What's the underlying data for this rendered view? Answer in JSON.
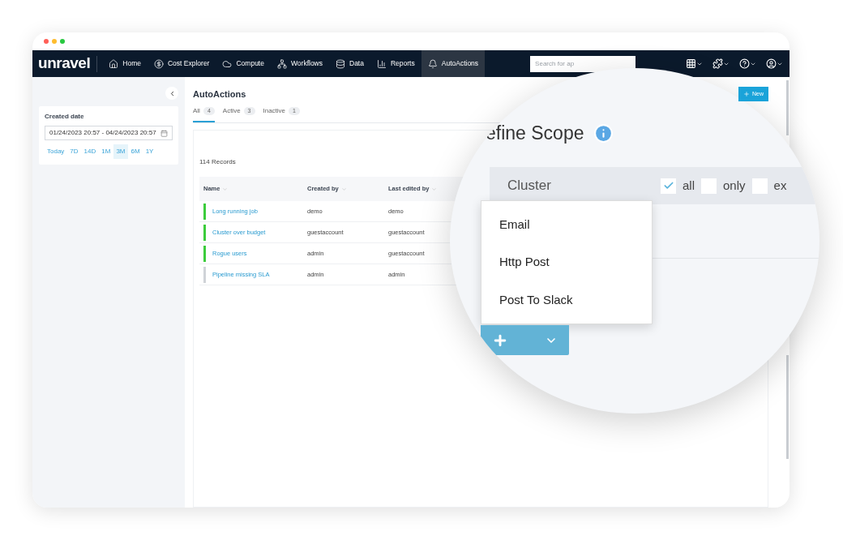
{
  "nav": {
    "logo": "unravel",
    "items": [
      {
        "label": "Home",
        "selected": false
      },
      {
        "label": "Cost Explorer",
        "selected": false
      },
      {
        "label": "Compute",
        "selected": false
      },
      {
        "label": "Workflows",
        "selected": false
      },
      {
        "label": "Data",
        "selected": false
      },
      {
        "label": "Reports",
        "selected": false
      },
      {
        "label": "AutoActions",
        "selected": true
      }
    ],
    "search": {
      "placeholder": "Search for ap"
    }
  },
  "sidebar": {
    "title": "Created date",
    "date_range": "01/24/2023 20:57 - 04/24/2023 20:57",
    "presets": [
      {
        "label": "Today",
        "selected": false
      },
      {
        "label": "7D",
        "selected": false
      },
      {
        "label": "14D",
        "selected": false
      },
      {
        "label": "1M",
        "selected": false
      },
      {
        "label": "3M",
        "selected": true
      },
      {
        "label": "6M",
        "selected": false
      },
      {
        "label": "1Y",
        "selected": false
      }
    ]
  },
  "page": {
    "title": "AutoActions",
    "new_button": "New",
    "tabs": [
      {
        "label": "All",
        "count": "4",
        "selected": true
      },
      {
        "label": "Active",
        "count": "3",
        "selected": false
      },
      {
        "label": "Inactive",
        "count": "1",
        "selected": false
      }
    ],
    "records": "114 Records",
    "table": {
      "columns": [
        "Name",
        "Created by",
        "Last edited by"
      ],
      "rows": [
        {
          "name": "Long running job",
          "created_by": "demo",
          "last_edited_by": "demo",
          "active": true
        },
        {
          "name": "Cluster over budget",
          "created_by": "guestaccount",
          "last_edited_by": "guestaccount",
          "active": true
        },
        {
          "name": "Rogue users",
          "created_by": "admin",
          "last_edited_by": "guestaccount",
          "active": true
        },
        {
          "name": "Pipeline missing SLA",
          "created_by": "admin",
          "last_edited_by": "admin",
          "active": false
        }
      ]
    }
  },
  "magnifier": {
    "heading": "efine Scope",
    "scope": {
      "label": "Cluster",
      "options": [
        {
          "label": "all",
          "checked": true
        },
        {
          "label": "only",
          "checked": false
        },
        {
          "label": "ex",
          "checked": false
        }
      ]
    },
    "menu": [
      "Email",
      "Http Post",
      "Post To Slack"
    ]
  }
}
